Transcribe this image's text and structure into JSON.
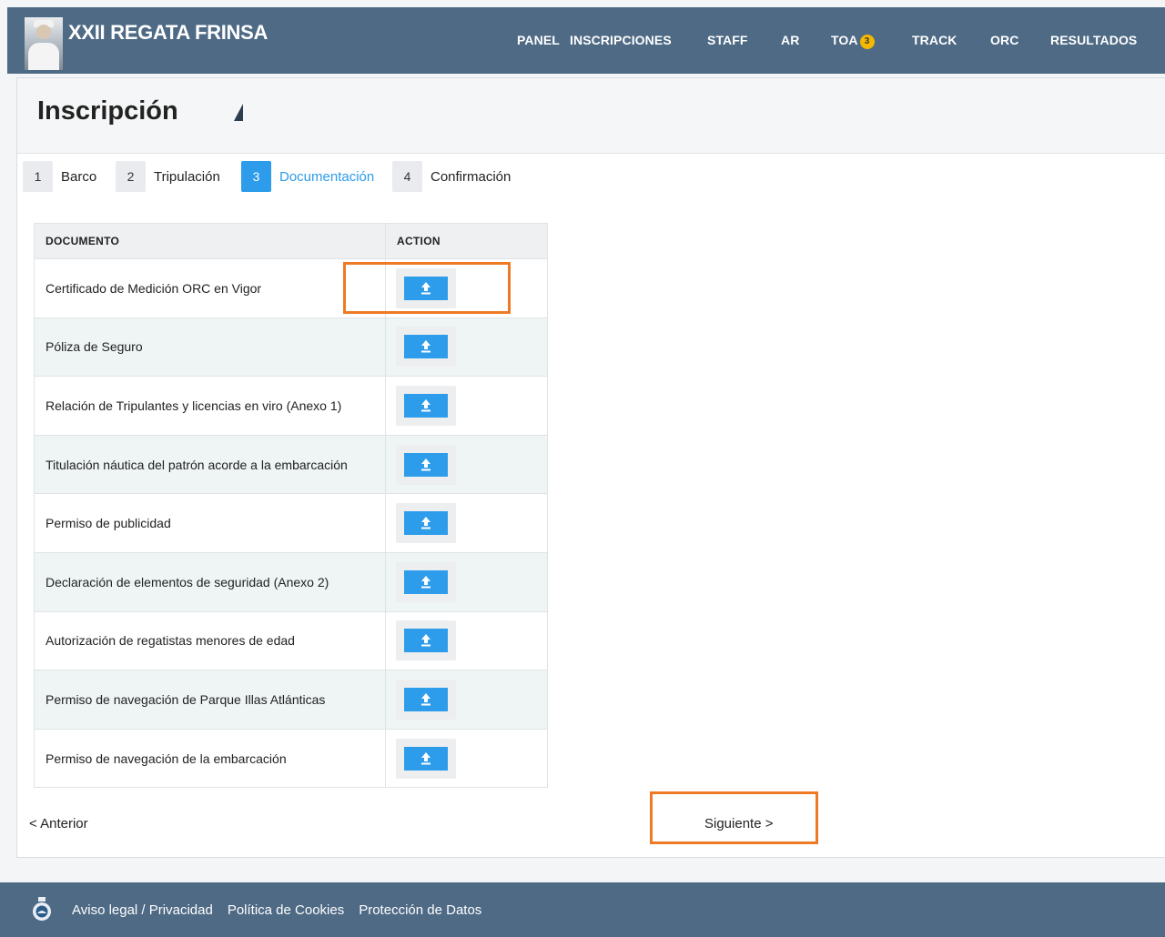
{
  "header": {
    "title": "XXII REGATA FRINSA",
    "nav": [
      {
        "label": "PANEL"
      },
      {
        "label": "INSCRIPCIONES"
      },
      {
        "label": "STAFF"
      },
      {
        "label": "AR"
      },
      {
        "label": "TOA",
        "badge": "3"
      },
      {
        "label": "TRACK"
      },
      {
        "label": "ORC"
      },
      {
        "label": "RESULTADOS"
      }
    ]
  },
  "page": {
    "title": "Inscripción"
  },
  "steps": [
    {
      "num": "1",
      "label": "Barco"
    },
    {
      "num": "2",
      "label": "Tripulación"
    },
    {
      "num": "3",
      "label": "Documentación",
      "active": true
    },
    {
      "num": "4",
      "label": "Confirmación"
    }
  ],
  "table": {
    "headers": [
      "DOCUMENTO",
      "ACTION"
    ],
    "rows": [
      "Certificado de Medición ORC en Vigor",
      "Póliza de Seguro",
      "Relación de Tripulantes y licencias en viro (Anexo 1)",
      "Titulación náutica del patrón acorde a la embarcación",
      "Permiso de publicidad",
      "Declaración de elementos de seguridad (Anexo 2)",
      "Autorización de regatistas menores de edad",
      "Permiso de navegación de Parque Illas Atlánticas",
      "Permiso de navegación de la embarcación"
    ]
  },
  "pager": {
    "prev": "< Anterior",
    "next": "Siguiente >"
  },
  "footer": {
    "links": [
      "Aviso legal / Privacidad",
      "Política de Cookies",
      "Protección de Datos"
    ]
  },
  "colors": {
    "header": "#4e6a85",
    "accent": "#2d9cea",
    "highlight": "#ee7a26"
  }
}
